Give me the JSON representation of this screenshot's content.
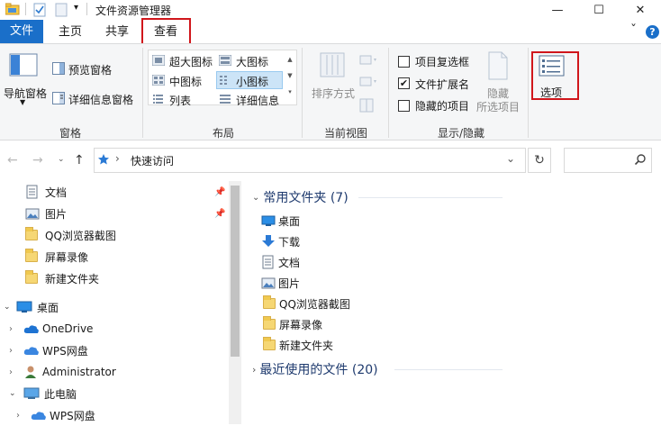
{
  "window": {
    "title": "文件资源管理器",
    "min_glyph": "—",
    "max_glyph": "☐",
    "close_glyph": "✕",
    "qa_dropdown": "▾"
  },
  "tabs": {
    "file": "文件",
    "home": "主页",
    "share": "共享",
    "view": "查看",
    "collapse_glyph": "ˇ",
    "help_glyph": "?"
  },
  "ribbon": {
    "panes": {
      "nav_pane": "导航窗格",
      "preview_pane": "预览窗格",
      "details_pane": "详细信息窗格",
      "group": "窗格"
    },
    "layout": {
      "xl_icons": "超大图标",
      "l_icons": "大图标",
      "m_icons": "中图标",
      "s_icons": "小图标",
      "list": "列表",
      "details": "详细信息",
      "group": "布局"
    },
    "current_view": {
      "sort_by": "排序方式",
      "group": "当前视图"
    },
    "show_hide": {
      "item_checkboxes": "项目复选框",
      "file_ext": "文件扩展名",
      "hidden_items": "隐藏的项目",
      "hide_sel_1": "隐藏",
      "hide_sel_2": "所选项目",
      "group": "显示/隐藏",
      "item_checkboxes_checked": false,
      "file_ext_checked": true,
      "hidden_items_checked": false
    },
    "options": {
      "label": "选项"
    }
  },
  "address": {
    "path": "快速访问",
    "sep": "›",
    "dropdown_glyph": "⌄",
    "refresh_glyph": "↻",
    "search_glyph": "⚲"
  },
  "nav": {
    "quick_items": [
      "文档",
      "图片",
      "QQ浏览器截图",
      "屏幕录像",
      "新建文件夹"
    ],
    "desktop": "桌面",
    "desktop_children": [
      "OneDrive",
      "WPS网盘",
      "Administrator",
      "此电脑"
    ],
    "pc_child": "WPS网盘"
  },
  "content": {
    "frequent_header": "常用文件夹 (7)",
    "frequent_items": [
      "桌面",
      "下载",
      "文档",
      "图片",
      "QQ浏览器截图",
      "屏幕录像",
      "新建文件夹"
    ],
    "recent_header": "最近使用的文件 (20)"
  }
}
